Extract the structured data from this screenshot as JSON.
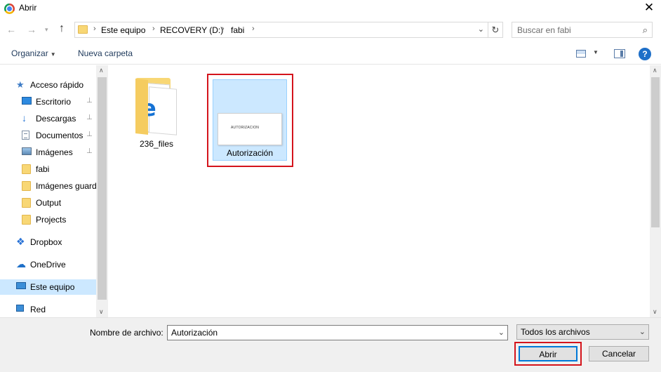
{
  "window": {
    "title": "Abrir",
    "close_glyph": "✕"
  },
  "nav": {
    "back_glyph": "←",
    "forward_glyph": "→",
    "recent_glyph": "⌄",
    "up_glyph": "↑"
  },
  "address": {
    "crumbs": [
      "Este equipo",
      "RECOVERY (D:)",
      "fabi"
    ],
    "separator": "›",
    "dropdown_glyph": "⌄",
    "refresh_glyph": "↻"
  },
  "search": {
    "placeholder": "Buscar en fabi",
    "value": ""
  },
  "toolbar": {
    "organize_label": "Organizar",
    "organize_dd": "▼",
    "new_folder_label": "Nueva carpeta",
    "view_dd": "▼",
    "help_glyph": "?"
  },
  "sidebar": {
    "items": [
      {
        "label": "Acceso rápido",
        "icon": "star-icon",
        "pinned": false
      },
      {
        "label": "Escritorio",
        "icon": "desktop-icon",
        "pinned": true
      },
      {
        "label": "Descargas",
        "icon": "download-icon",
        "pinned": true
      },
      {
        "label": "Documentos",
        "icon": "document-icon",
        "pinned": true
      },
      {
        "label": "Imágenes",
        "icon": "images-icon",
        "pinned": true
      },
      {
        "label": "fabi",
        "icon": "folder-icon",
        "pinned": false
      },
      {
        "label": "Imágenes guard",
        "icon": "folder-icon",
        "pinned": false
      },
      {
        "label": "Output",
        "icon": "folder-icon",
        "pinned": false
      },
      {
        "label": "Projects",
        "icon": "folder-icon",
        "pinned": false
      },
      {
        "label": "Dropbox",
        "icon": "dropbox-icon",
        "pinned": false
      },
      {
        "label": "OneDrive",
        "icon": "onedrive-icon",
        "pinned": false
      },
      {
        "label": "Este equipo",
        "icon": "computer-icon",
        "pinned": false,
        "selected": true
      },
      {
        "label": "Red",
        "icon": "network-icon",
        "pinned": false
      }
    ],
    "pin_glyph": "📌"
  },
  "files": [
    {
      "name": "236_files",
      "type": "folder",
      "selected": false
    },
    {
      "name": "Autorización",
      "type": "document",
      "selected": true,
      "thumb_text": "AUTORIZACION"
    }
  ],
  "scroll": {
    "up_glyph": "▲",
    "down_glyph": "▼"
  },
  "footer": {
    "filename_label": "Nombre de archivo:",
    "filename_value": "Autorización",
    "filename_dd": "⌄",
    "filter_value": "Todos los archivos",
    "filter_dd": "⌄",
    "open_label": "Abrir",
    "cancel_label": "Cancelar"
  },
  "colors": {
    "selection": "#cce8ff",
    "highlight_frame": "#d4141c",
    "default_button_border": "#0078d7"
  }
}
